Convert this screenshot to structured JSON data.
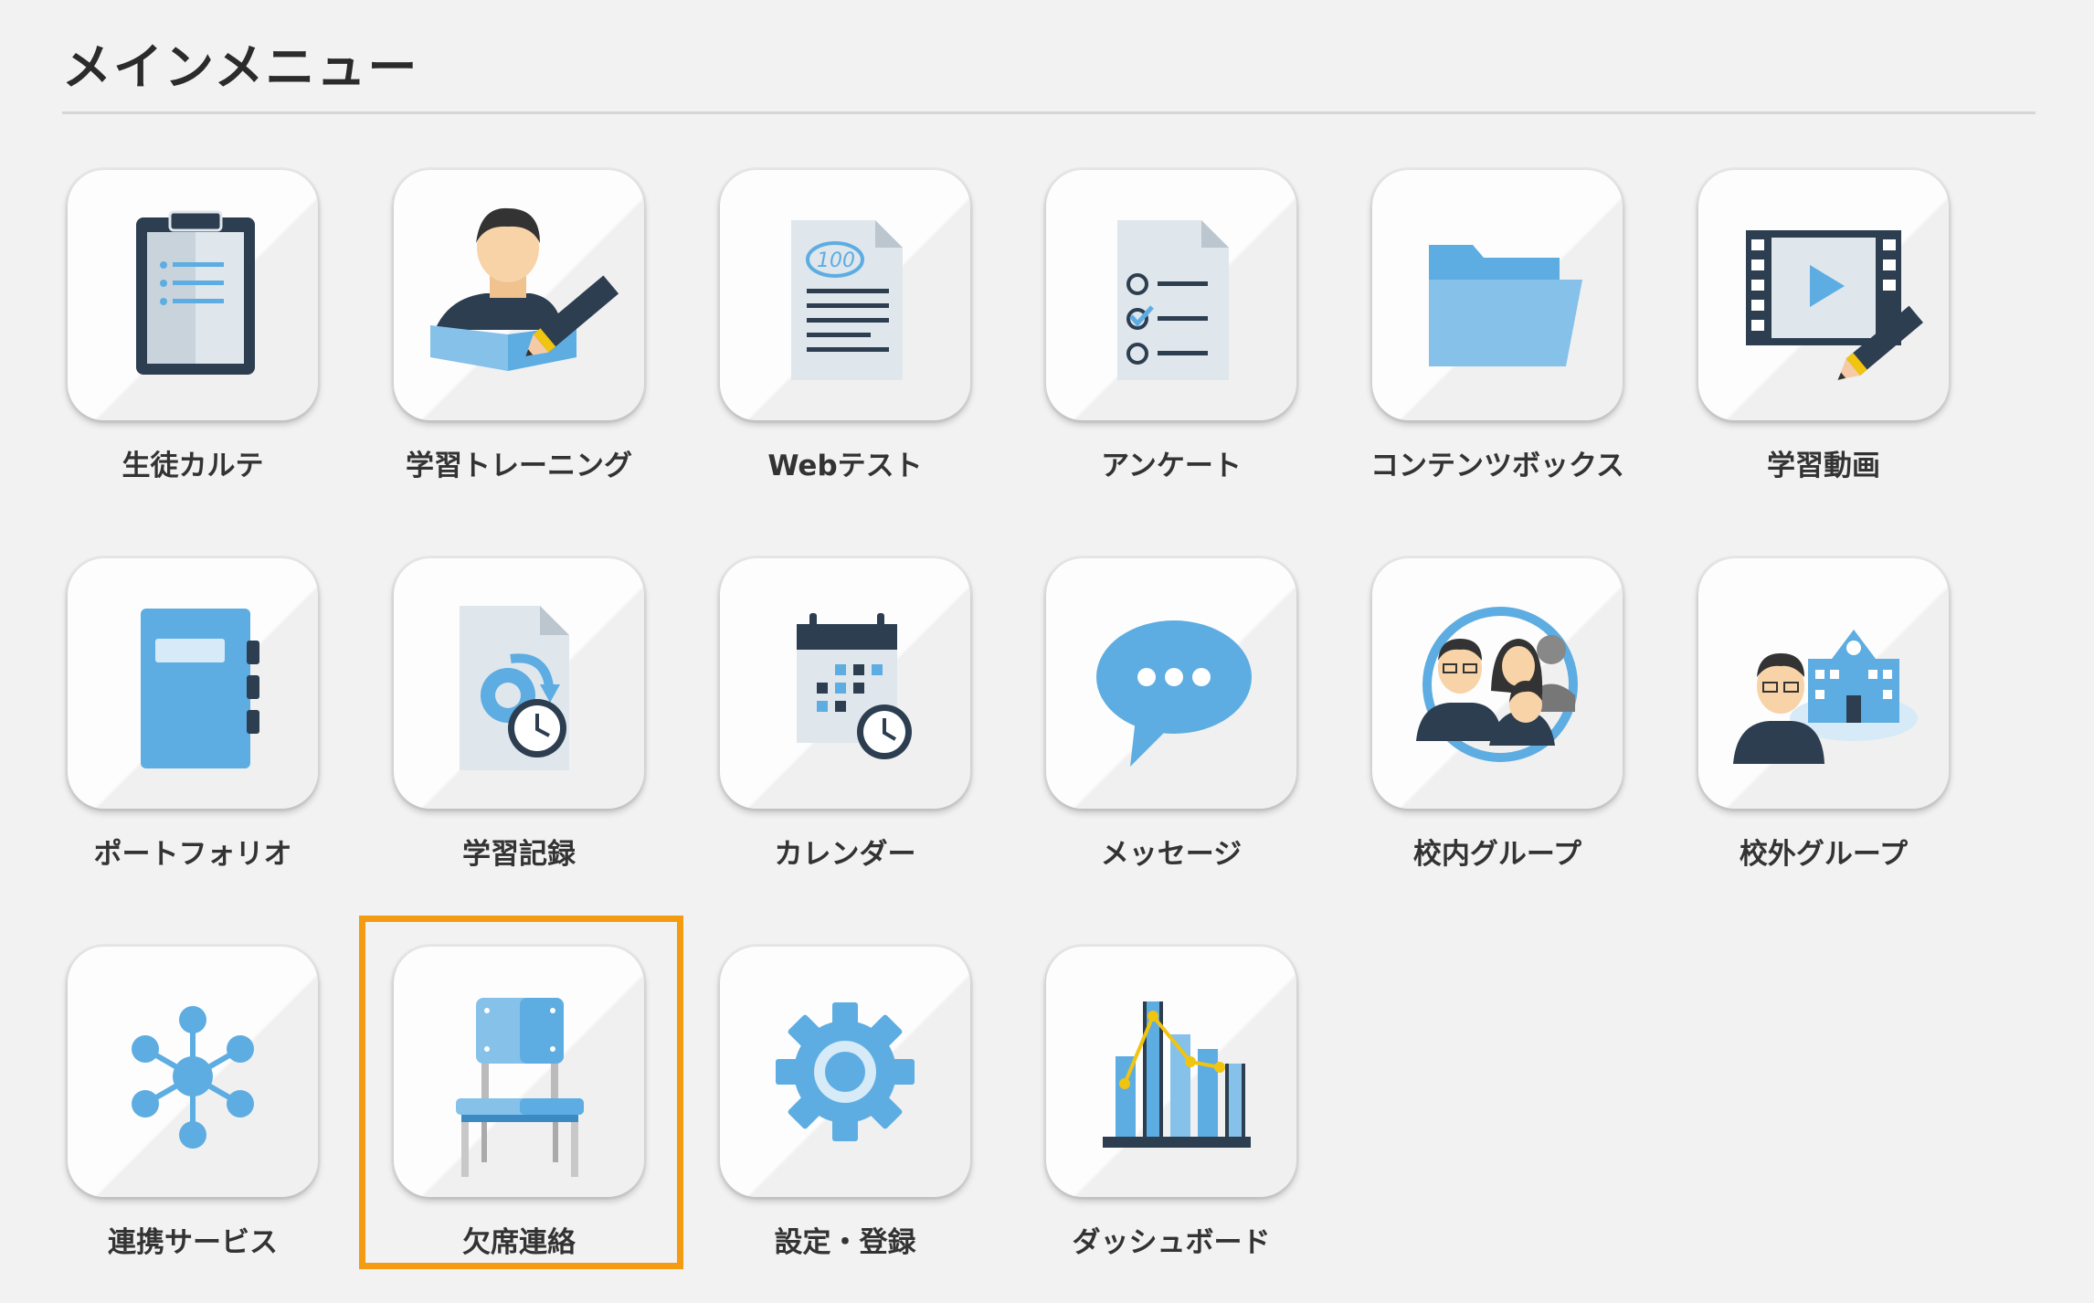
{
  "header": {
    "title": "メインメニュー"
  },
  "menu": [
    {
      "label": "生徒カルテ",
      "icon": "clipboard-icon"
    },
    {
      "label": "学習トレーニング",
      "icon": "student-study-icon"
    },
    {
      "label": "Webテスト",
      "icon": "web-test-icon"
    },
    {
      "label": "アンケート",
      "icon": "survey-checklist-icon"
    },
    {
      "label": "コンテンツボックス",
      "icon": "folder-icon"
    },
    {
      "label": "学習動画",
      "icon": "video-edit-icon"
    },
    {
      "label": "ポートフォリオ",
      "icon": "notebook-icon"
    },
    {
      "label": "学習記録",
      "icon": "study-record-clock-icon"
    },
    {
      "label": "カレンダー",
      "icon": "calendar-clock-icon"
    },
    {
      "label": "メッセージ",
      "icon": "speech-bubble-icon"
    },
    {
      "label": "校内グループ",
      "icon": "school-group-people-icon"
    },
    {
      "label": "校外グループ",
      "icon": "external-group-school-icon"
    },
    {
      "label": "連携サービス",
      "icon": "network-hub-icon"
    },
    {
      "label": "欠席連絡",
      "icon": "chair-icon"
    },
    {
      "label": "設定・登録",
      "icon": "gear-icon"
    },
    {
      "label": "ダッシュボード",
      "icon": "bar-chart-icon"
    }
  ],
  "selected_item": "欠席連絡",
  "colors": {
    "accent_blue": "#5dade2",
    "dark_navy": "#2c3e50",
    "highlight_orange": "#f39c12"
  }
}
